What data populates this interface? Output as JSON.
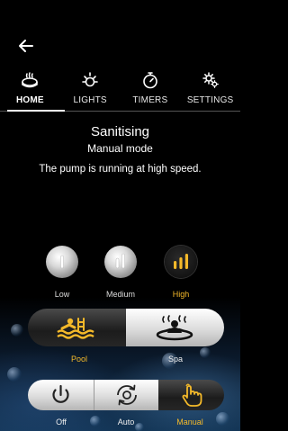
{
  "tabs": [
    {
      "label": "HOME",
      "icon": "spa-icon",
      "active": true
    },
    {
      "label": "LIGHTS",
      "icon": "light-icon",
      "active": false
    },
    {
      "label": "TIMERS",
      "icon": "timer-icon",
      "active": false
    },
    {
      "label": "SETTINGS",
      "icon": "settings-icon",
      "active": false
    }
  ],
  "status": {
    "title": "Sanitising",
    "mode": "Manual mode",
    "message": "The pump is running at high speed."
  },
  "speed": {
    "options": [
      {
        "label": "Low",
        "selected": false
      },
      {
        "label": "Medium",
        "selected": false
      },
      {
        "label": "High",
        "selected": true
      }
    ]
  },
  "target": {
    "options": [
      {
        "label": "Pool",
        "icon": "pool-swimmer-icon",
        "selected": true
      },
      {
        "label": "Spa",
        "icon": "spa-bather-icon",
        "selected": false
      }
    ]
  },
  "pump_mode": {
    "options": [
      {
        "label": "Off",
        "icon": "power-icon",
        "selected": false
      },
      {
        "label": "Auto",
        "icon": "auto-cycle-icon",
        "selected": false
      },
      {
        "label": "Manual",
        "icon": "hand-touch-icon",
        "selected": true
      }
    ]
  },
  "colors": {
    "accent": "#f4b92a",
    "background": "#000000"
  }
}
